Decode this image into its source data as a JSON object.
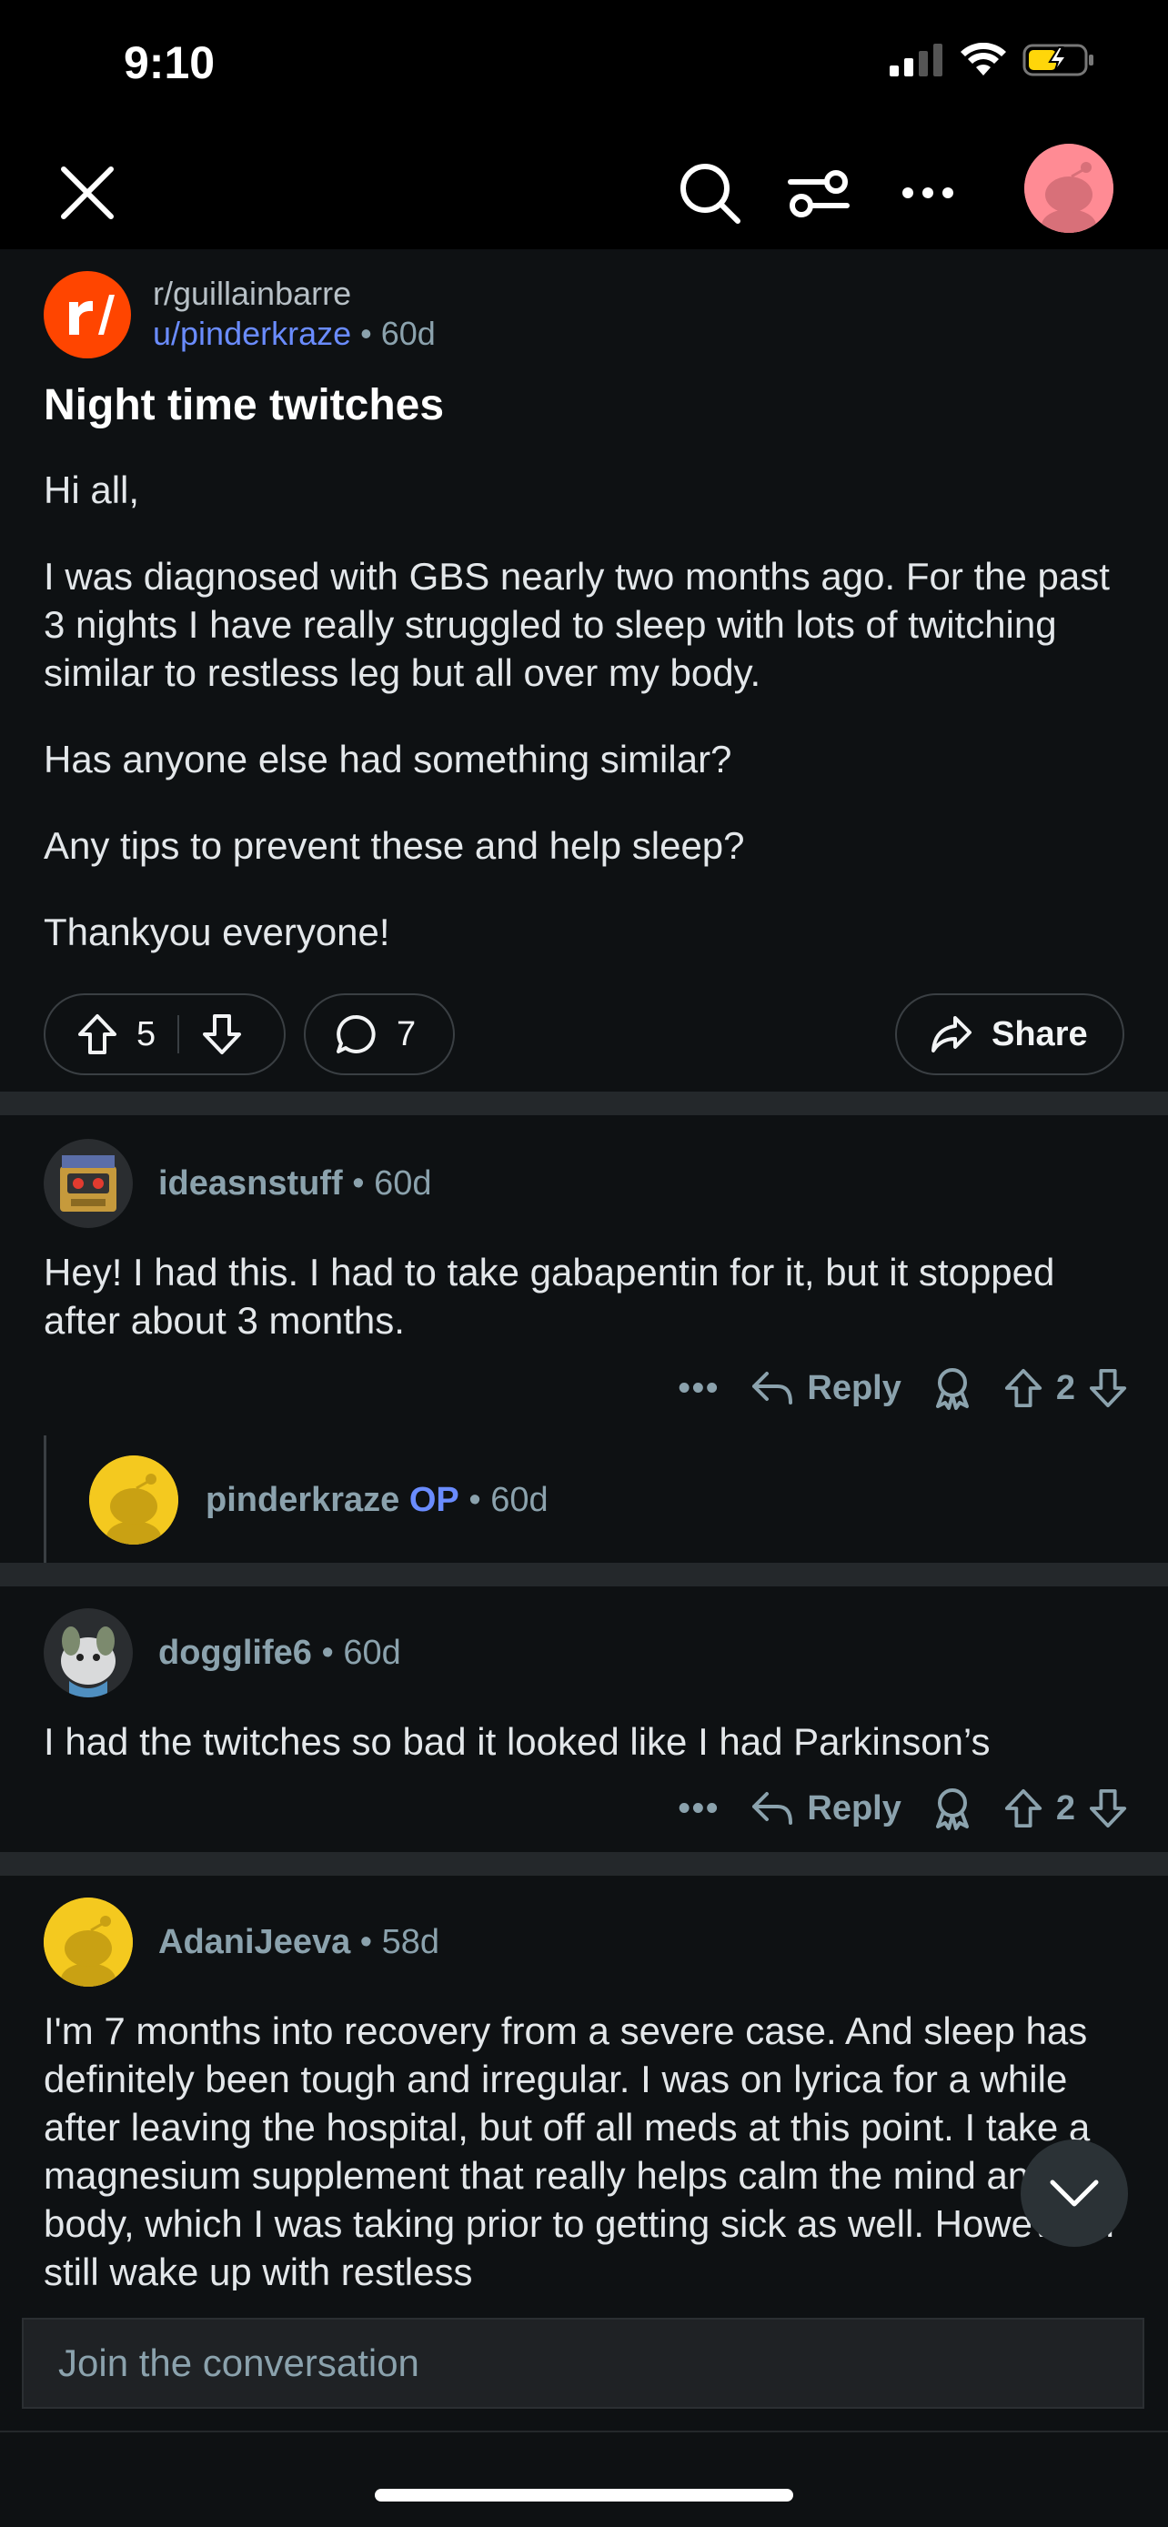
{
  "status": {
    "time": "9:10"
  },
  "post": {
    "subreddit": "r/guillainbarre",
    "author": "u/pinderkraze",
    "age": "60d",
    "title": "Night time twitches",
    "body": [
      "Hi all,",
      "I was diagnosed with GBS nearly two months ago. For the past 3 nights I have really struggled to sleep with lots of twitching similar to restless leg but all over my body.",
      "Has anyone else had something similar?",
      "Any tips to prevent these and help sleep?",
      "Thankyou everyone!"
    ],
    "votes": "5",
    "comments": "7",
    "share_label": "Share"
  },
  "comments": [
    {
      "user": "ideasnstuff",
      "age": "60d",
      "body": "Hey! I had this. I had to take gabapentin for it, but it stopped after about 3 months.",
      "reply_label": "Reply",
      "votes": "2",
      "more": "•••"
    },
    {
      "user": "pinderkraze",
      "op_label": "OP",
      "age": "60d"
    },
    {
      "user": "dogglife6",
      "age": "60d",
      "body": "I had the twitches so bad it looked like I had Parkinson’s",
      "reply_label": "Reply",
      "votes": "2",
      "more": "•••"
    },
    {
      "user": "AdaniJeeva",
      "age": "58d",
      "body": "I'm 7 months into recovery from a severe case. And sleep has definitely been tough and irregular. I was on lyrica for a while after leaving the hospital, but off all meds at this point. I take a magnesium supplement that really helps calm the mind and body, which I was taking prior to getting sick as well. However, I still wake up with restless"
    }
  ],
  "composer": {
    "placeholder": "Join the conversation"
  },
  "colors": {
    "accent": "#ff4500",
    "op": "#6a8cff",
    "avatar_yellow": "#f4c91f",
    "avatar_pink": "#ff8b94"
  }
}
